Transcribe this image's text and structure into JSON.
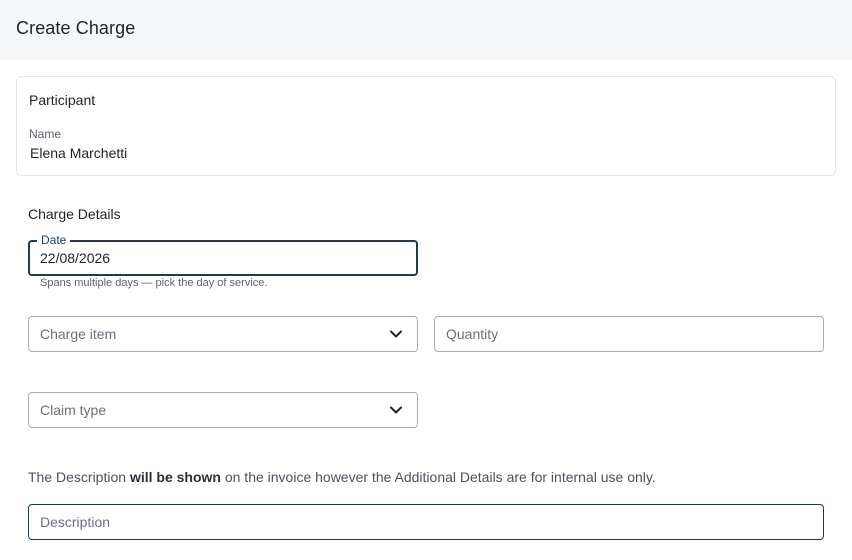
{
  "header": {
    "title": "Create Charge"
  },
  "participant": {
    "heading": "Participant",
    "name_label": "Name",
    "name_value": "Elena Marchetti"
  },
  "charge_details": {
    "heading": "Charge Details",
    "date": {
      "label": "Date",
      "value": "22/08/2026",
      "helper": "Spans multiple days — pick the day of service."
    },
    "charge_item": {
      "placeholder": "Charge item",
      "icon": "chevron-down-icon"
    },
    "quantity": {
      "placeholder": "Quantity"
    },
    "claim_type": {
      "placeholder": "Claim type",
      "icon": "chevron-down-icon"
    },
    "note": {
      "prefix": "The Description ",
      "emphasis": "will be shown",
      "suffix": " on the invoice however the Additional Details are for internal use only."
    },
    "description": {
      "placeholder": "Description"
    }
  },
  "colors": {
    "header_bg": "#f6f7f9",
    "focus_border": "#1d3a57",
    "field_border": "#a8adb5"
  }
}
